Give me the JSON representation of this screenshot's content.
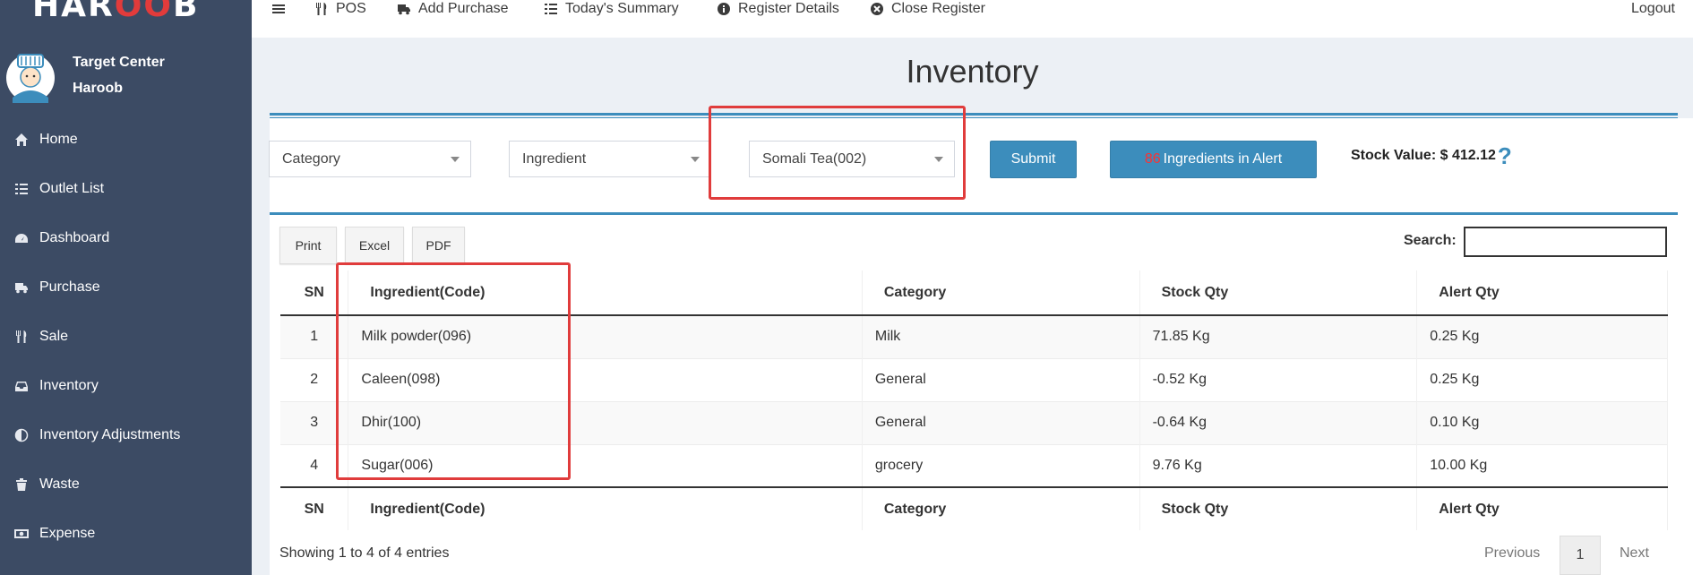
{
  "app": {
    "brand_left": "HAR",
    "brand_mid": "OO",
    "brand_right": "B"
  },
  "user": {
    "name": "Target Center",
    "org": "Haroob"
  },
  "sidebar": {
    "items": [
      {
        "label": "Home",
        "icon": "home-icon"
      },
      {
        "label": "Outlet List",
        "icon": "list-icon"
      },
      {
        "label": "Dashboard",
        "icon": "dashboard-icon"
      },
      {
        "label": "Purchase",
        "icon": "truck-icon"
      },
      {
        "label": "Sale",
        "icon": "cutlery-icon"
      },
      {
        "label": "Inventory",
        "icon": "inbox-icon"
      },
      {
        "label": "Inventory Adjustments",
        "icon": "adjust-icon"
      },
      {
        "label": "Waste",
        "icon": "trash-icon"
      },
      {
        "label": "Expense",
        "icon": "money-icon"
      }
    ]
  },
  "topbar": {
    "pos": "POS",
    "add_purchase": "Add Purchase",
    "todays_summary": "Today's Summary",
    "register_details": "Register Details",
    "close_register": "Close Register",
    "logout": "Logout"
  },
  "page": {
    "title": "Inventory"
  },
  "filters": {
    "category_placeholder": "Category",
    "ingredient_placeholder": "Ingredient",
    "food_menu_value": "Somali Tea(002)",
    "submit_label": "Submit",
    "alert_count": "86",
    "alert_label": "Ingredients in Alert",
    "stock_value_label": "Stock Value: $ 412.12",
    "help_glyph": "?"
  },
  "export": {
    "print": "Print",
    "excel": "Excel",
    "pdf": "PDF"
  },
  "search": {
    "label": "Search:"
  },
  "table": {
    "headers": [
      "SN",
      "Ingredient(Code)",
      "Category",
      "Stock Qty",
      "Alert Qty"
    ],
    "rows": [
      {
        "sn": "1",
        "ingredient": "Milk powder(096)",
        "category": "Milk",
        "stock": "71.85 Kg",
        "alert": "0.25 Kg",
        "stock_low": false
      },
      {
        "sn": "2",
        "ingredient": "Caleen(098)",
        "category": "General",
        "stock": "-0.52 Kg",
        "alert": "0.25 Kg",
        "stock_low": true
      },
      {
        "sn": "3",
        "ingredient": "Dhir(100)",
        "category": "General",
        "stock": "-0.64 Kg",
        "alert": "0.10 Kg",
        "stock_low": true
      },
      {
        "sn": "4",
        "ingredient": "Sugar(006)",
        "category": "grocery",
        "stock": "9.76 Kg",
        "alert": "10.00 Kg",
        "stock_low": true
      }
    ]
  },
  "pagination": {
    "info": "Showing 1 to 4 of 4 entries",
    "previous": "Previous",
    "current": "1",
    "next": "Next"
  },
  "colors": {
    "sidebar": "#3c4b64",
    "accent": "#3c8dbc",
    "alert_red": "#e82e2e",
    "highlight": "#e03c3c"
  }
}
